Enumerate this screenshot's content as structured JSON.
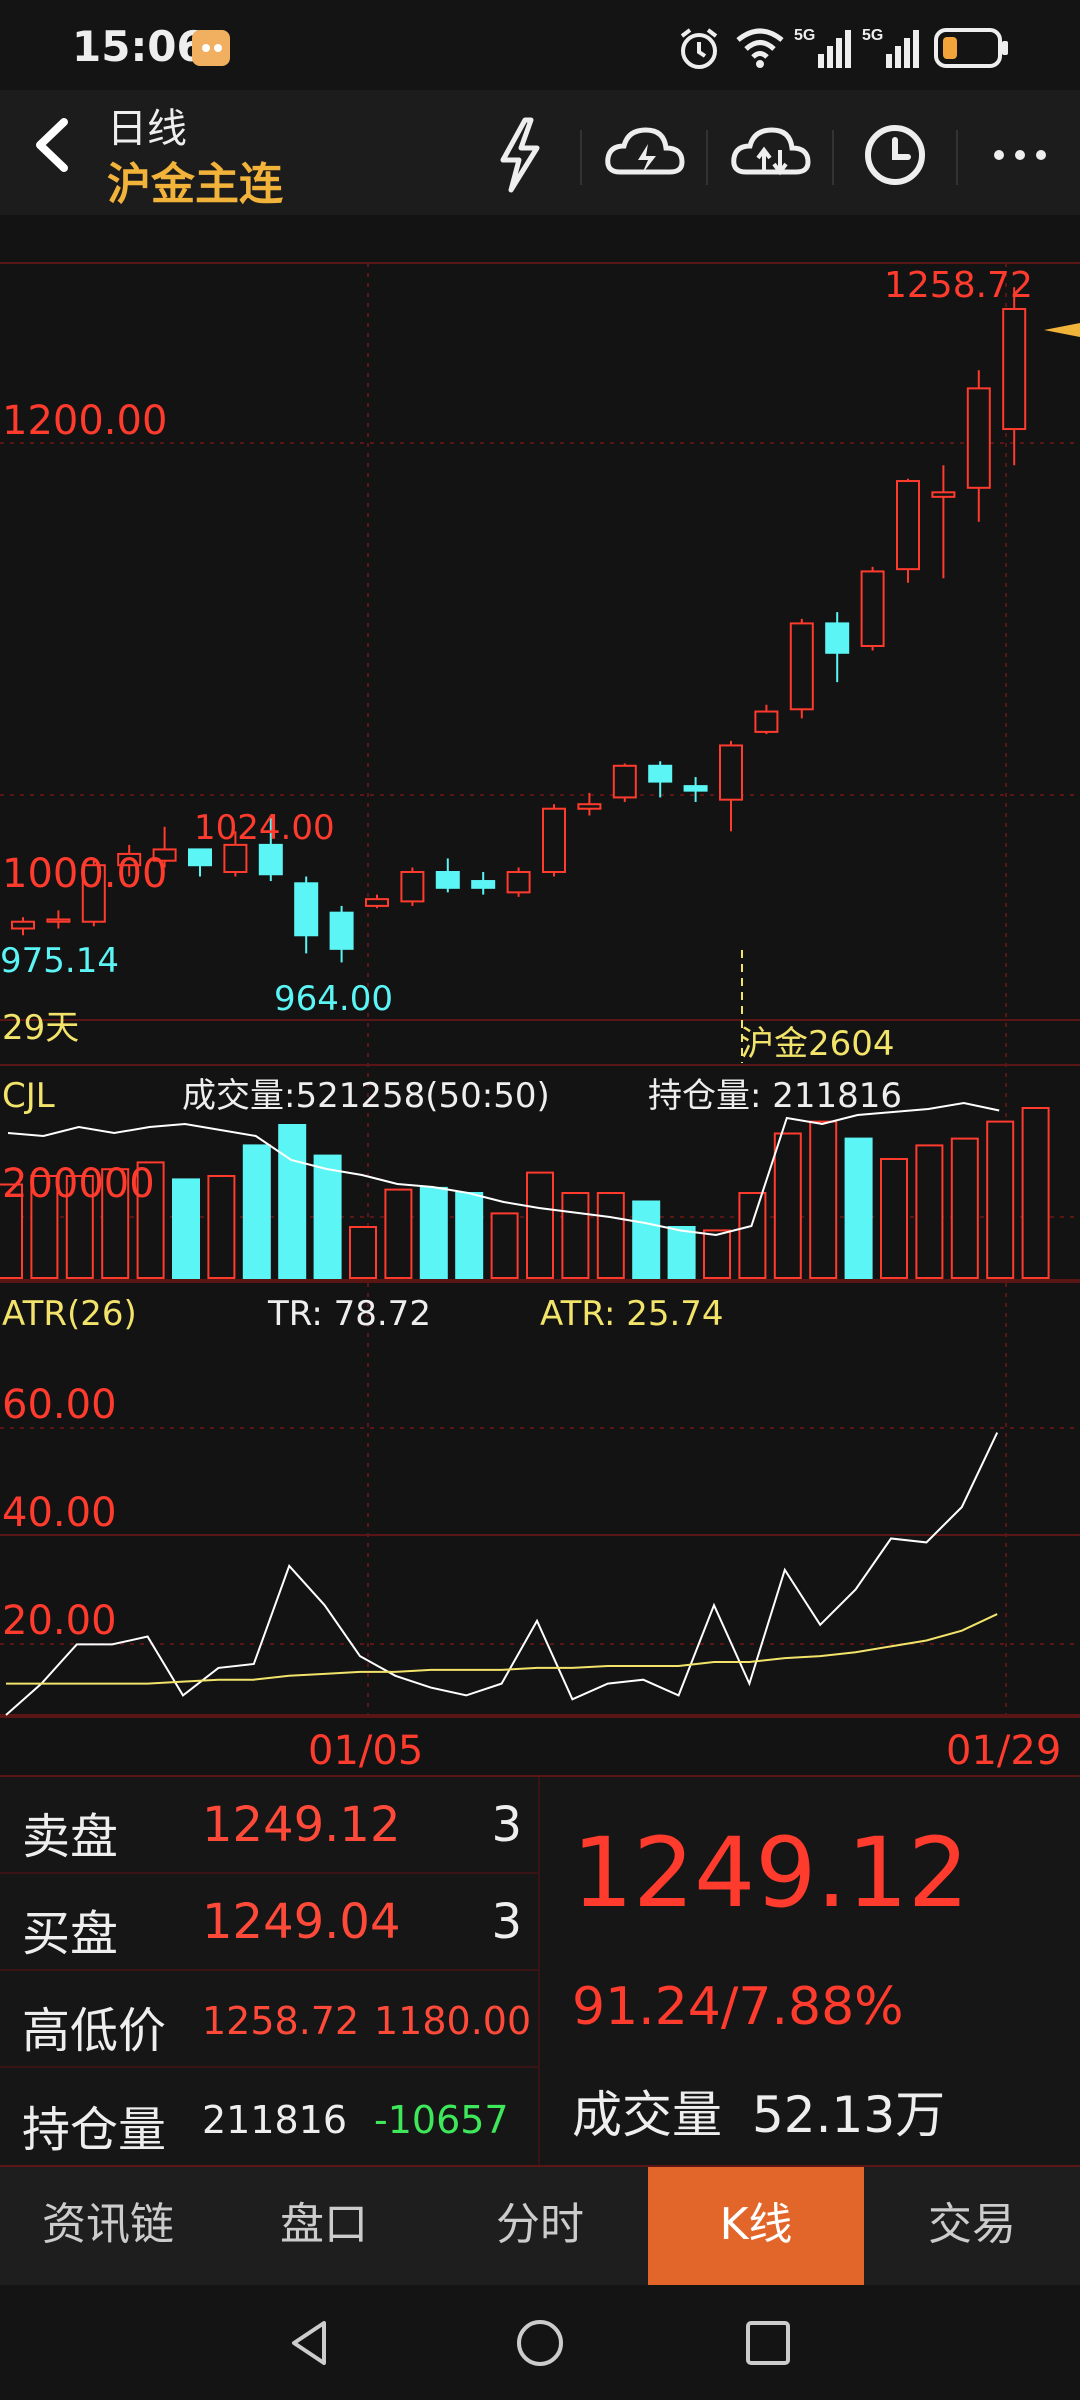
{
  "status": {
    "time": "15:06",
    "signal_1": "5G",
    "signal_2": "5G"
  },
  "nav": {
    "period": "日线",
    "instrument": "沪金主连"
  },
  "icons": [
    "back-icon",
    "lightning-icon",
    "cloud-lightning-icon",
    "cloud-sync-icon",
    "clock-icon",
    "more-icon"
  ],
  "chart": {
    "price_labels": {
      "y_1200": "1200.00",
      "y_1000": "1000.00",
      "high": "1258.72",
      "high_local": "1024.00",
      "low": "964.00",
      "low_left": "975.14"
    },
    "days_label": "29天",
    "contract_label": "沪金2604",
    "volume": {
      "title": "CJL",
      "volume_text": "成交量:521258(50:50)",
      "oi_text": "持仓量: 211816",
      "axis_label": "200000"
    },
    "atr": {
      "title": "ATR(26)",
      "tr_text": "TR: 78.72",
      "atr_text": "ATR: 25.74",
      "y60": "60.00",
      "y40": "40.00",
      "y20": "20.00"
    },
    "dates": {
      "d1": "01/05",
      "d2": "01/29"
    }
  },
  "chart_data": {
    "type": "candlestick",
    "price_axis": {
      "ylim": [
        955,
        1270
      ],
      "labels": [
        1000,
        1200
      ]
    },
    "candles": [
      {
        "o": 975,
        "h": 980,
        "l": 972,
        "c": 978
      },
      {
        "o": 978,
        "h": 983,
        "l": 975,
        "c": 979
      },
      {
        "o": 978,
        "h": 1005,
        "l": 976,
        "c": 1003
      },
      {
        "o": 1003,
        "h": 1012,
        "l": 998,
        "c": 1008
      },
      {
        "o": 1005,
        "h": 1020,
        "l": 1002,
        "c": 1010
      },
      {
        "o": 1010,
        "h": 1008,
        "l": 998,
        "c": 1003
      },
      {
        "o": 1000,
        "h": 1018,
        "l": 998,
        "c": 1012
      },
      {
        "o": 1012,
        "h": 1024,
        "l": 996,
        "c": 999
      },
      {
        "o": 995,
        "h": 998,
        "l": 964,
        "c": 972
      },
      {
        "o": 982,
        "h": 985,
        "l": 960,
        "c": 966
      },
      {
        "o": 985,
        "h": 990,
        "l": 984,
        "c": 988
      },
      {
        "o": 987,
        "h": 1002,
        "l": 985,
        "c": 1000
      },
      {
        "o": 1000,
        "h": 1006,
        "l": 991,
        "c": 993
      },
      {
        "o": 996,
        "h": 1000,
        "l": 990,
        "c": 993
      },
      {
        "o": 991,
        "h": 1002,
        "l": 989,
        "c": 1000
      },
      {
        "o": 1000,
        "h": 1030,
        "l": 998,
        "c": 1028
      },
      {
        "o": 1028,
        "h": 1035,
        "l": 1025,
        "c": 1030
      },
      {
        "o": 1033,
        "h": 1048,
        "l": 1031,
        "c": 1047
      },
      {
        "o": 1047,
        "h": 1049,
        "l": 1033,
        "c": 1040
      },
      {
        "o": 1038,
        "h": 1042,
        "l": 1031,
        "c": 1036
      },
      {
        "o": 1032,
        "h": 1058,
        "l": 1018,
        "c": 1056
      },
      {
        "o": 1062,
        "h": 1074,
        "l": 1061,
        "c": 1071
      },
      {
        "o": 1072,
        "h": 1112,
        "l": 1068,
        "c": 1110
      },
      {
        "o": 1110,
        "h": 1115,
        "l": 1084,
        "c": 1097
      },
      {
        "o": 1100,
        "h": 1135,
        "l": 1098,
        "c": 1133
      },
      {
        "o": 1134,
        "h": 1174,
        "l": 1128,
        "c": 1173
      },
      {
        "o": 1166,
        "h": 1180,
        "l": 1130,
        "c": 1168
      },
      {
        "o": 1170,
        "h": 1222,
        "l": 1155,
        "c": 1214
      },
      {
        "o": 1196,
        "h": 1258.72,
        "l": 1180,
        "c": 1249.12
      }
    ],
    "volume_bars": [
      0.55,
      0.6,
      0.6,
      0.64,
      0.68,
      0.58,
      0.6,
      0.78,
      0.9,
      0.72,
      0.3,
      0.52,
      0.53,
      0.5,
      0.38,
      0.62,
      0.5,
      0.5,
      0.45,
      0.3,
      0.28,
      0.5,
      0.85,
      0.92,
      0.82,
      0.7,
      0.78,
      0.82,
      0.92,
      1.0
    ],
    "volume_bull": [
      true,
      true,
      true,
      true,
      true,
      false,
      true,
      false,
      false,
      false,
      true,
      true,
      false,
      false,
      true,
      true,
      true,
      true,
      false,
      false,
      true,
      true,
      true,
      true,
      false,
      true,
      true,
      true,
      true,
      true
    ],
    "oi_line": [
      0.7,
      0.68,
      0.74,
      0.7,
      0.74,
      0.76,
      0.72,
      0.68,
      0.52,
      0.46,
      0.42,
      0.36,
      0.34,
      0.3,
      0.24,
      0.2,
      0.17,
      0.14,
      0.1,
      0.05,
      0.02,
      0.08,
      0.8,
      0.76,
      0.82,
      0.84,
      0.86,
      0.9,
      0.85
    ],
    "atr_axis": {
      "ylim": [
        0,
        80
      ]
    },
    "tr_line": [
      0,
      8,
      18,
      18,
      20,
      5,
      12,
      13,
      38,
      28,
      15,
      10,
      7,
      5,
      8,
      24,
      4,
      8,
      9,
      5,
      28,
      8,
      37,
      23,
      32,
      45,
      44,
      53,
      72
    ],
    "atr_line": [
      8,
      8,
      8,
      8,
      8,
      8.5,
      9,
      9,
      10,
      10.5,
      11,
      11,
      11.5,
      11.5,
      11.5,
      12,
      12,
      12.5,
      12.5,
      12.5,
      13.5,
      13.5,
      14.5,
      15,
      16,
      17.5,
      19,
      21.5,
      25.74
    ]
  },
  "quote": {
    "ask_label": "卖盘",
    "ask_price": "1249.12",
    "ask_qty": "3",
    "bid_label": "买盘",
    "bid_price": "1249.04",
    "bid_qty": "3",
    "hl_label": "高低价",
    "high": "1258.72",
    "low": "1180.00",
    "oi_label": "持仓量",
    "oi_value": "211816",
    "oi_change": "-10657",
    "last_price": "1249.12",
    "change": "91.24/7.88%",
    "volume_label": "成交量",
    "volume_value": "52.13万"
  },
  "tabs": [
    "资讯链",
    "盘口",
    "分时",
    "K线",
    "交易"
  ],
  "active_tab": 3,
  "colors": {
    "up": "#ff3b2e",
    "down": "#5cf5f5",
    "accent": "#f2b33a",
    "tab_active": "#e2652a"
  }
}
